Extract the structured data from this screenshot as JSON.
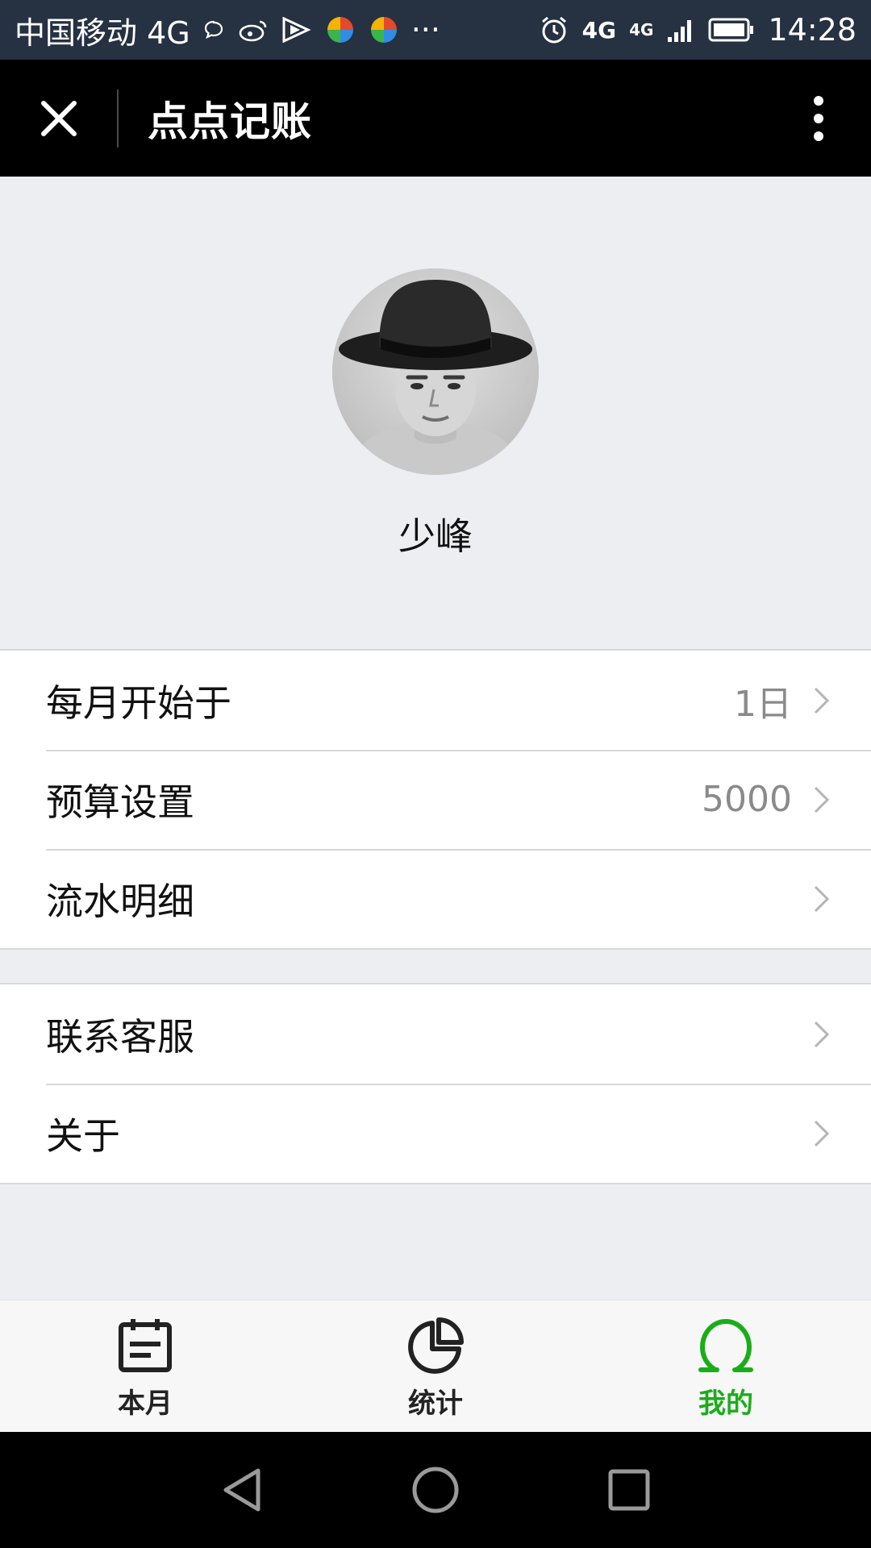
{
  "status_bar": {
    "carrier": "中国移动 4G",
    "more": "···",
    "network_1": "4G",
    "network_2": "4G",
    "time": "14:28"
  },
  "title_bar": {
    "title": "点点记账"
  },
  "profile": {
    "username": "少峰"
  },
  "settings_group": [
    {
      "label": "每月开始于",
      "value": "1日"
    },
    {
      "label": "预算设置",
      "value": "5000"
    },
    {
      "label": "流水明细",
      "value": ""
    }
  ],
  "support_group": [
    {
      "label": "联系客服"
    },
    {
      "label": "关于"
    }
  ],
  "tab_bar": {
    "tabs": [
      {
        "label": "本月",
        "icon": "calendar-icon"
      },
      {
        "label": "统计",
        "icon": "pie-chart-icon"
      },
      {
        "label": "我的",
        "icon": "profile-icon",
        "active": true
      }
    ]
  },
  "colors": {
    "accent": "#1aad19",
    "title_bar": "#000000",
    "status_bar": "#263142",
    "background": "#edeef2"
  }
}
